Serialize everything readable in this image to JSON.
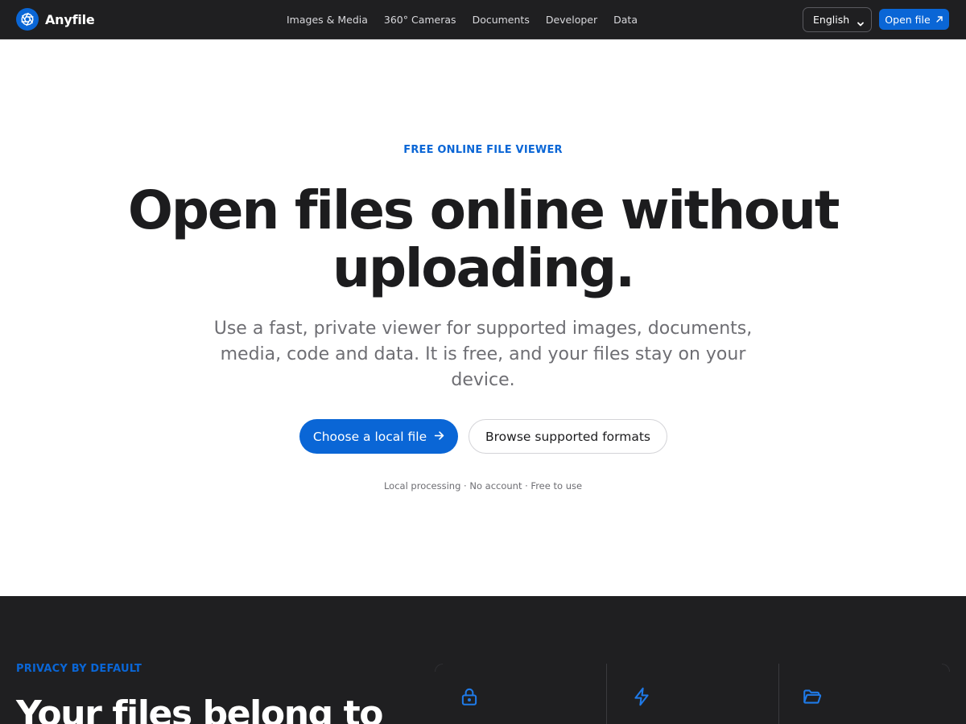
{
  "topbar": {
    "brand_name": "Anyfile",
    "nav": [
      {
        "label": "Images & Media"
      },
      {
        "label": "360° Cameras"
      },
      {
        "label": "Documents"
      },
      {
        "label": "Developer"
      },
      {
        "label": "Data"
      }
    ],
    "language": {
      "selected": "English"
    },
    "open_button": "Open file"
  },
  "hero": {
    "eyebrow": "FREE ONLINE FILE VIEWER",
    "headline_line1": "Open files online without",
    "headline_line2": "uploading.",
    "lead": "Use a fast, private viewer for supported images, documents, media, code and data. It is free, and your files stay on your device.",
    "primary_cta": "Choose a local file",
    "secondary_cta": "Browse supported formats",
    "meta": "Local processing · No account · Free to use"
  },
  "privacy": {
    "eyebrow": "PRIVACY BY DEFAULT",
    "title": "Your files belong to",
    "features": [
      {
        "icon": "lock-icon"
      },
      {
        "icon": "lightning-icon"
      },
      {
        "icon": "folder-open-icon"
      }
    ]
  },
  "colors": {
    "accent": "#0a66d6",
    "dark_bg": "#1f1f21",
    "text": "#1c1c1e",
    "muted": "#6e6e73"
  }
}
